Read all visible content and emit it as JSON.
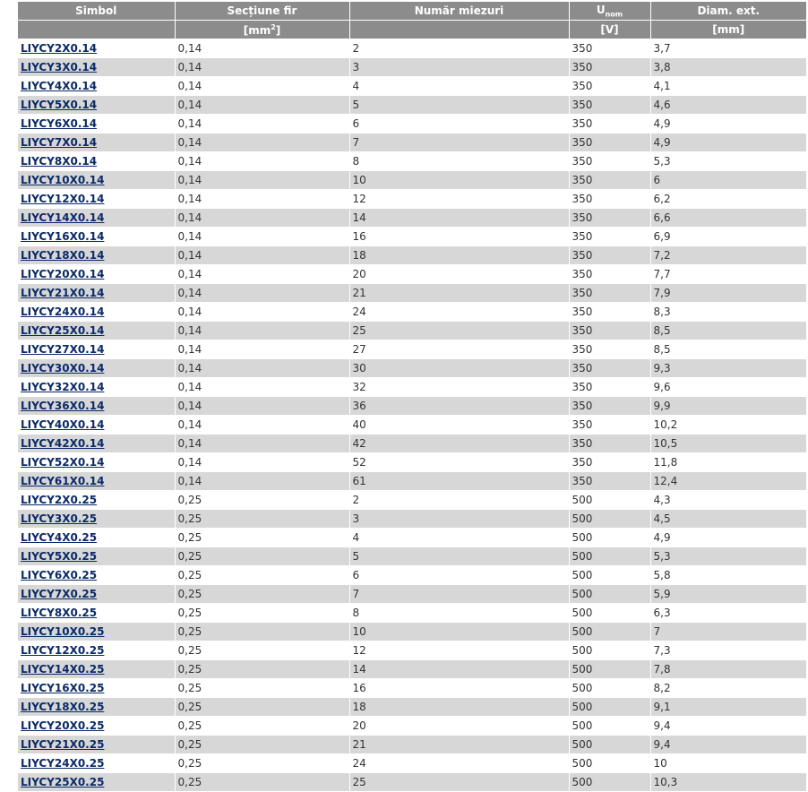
{
  "table": {
    "headers": {
      "simbol": "Simbol",
      "sectiune": "Secțiune fir",
      "numar": "Număr miezuri",
      "unom_u": "U",
      "unom_sub": "nom",
      "diam": "Diam. ext."
    },
    "units": {
      "simbol": "",
      "sectiune_pre": "[mm",
      "sectiune_sup": "2",
      "sectiune_post": "]",
      "numar": "",
      "unom": "[V]",
      "diam": "[mm]"
    },
    "rows": [
      {
        "simbol": "LIYCY2X0.14",
        "sectiune": "0,14",
        "miezuri": "2",
        "unom": "350",
        "diam": "3,7"
      },
      {
        "simbol": "LIYCY3X0.14",
        "sectiune": "0,14",
        "miezuri": "3",
        "unom": "350",
        "diam": "3,8"
      },
      {
        "simbol": "LIYCY4X0.14",
        "sectiune": "0,14",
        "miezuri": "4",
        "unom": "350",
        "diam": "4,1"
      },
      {
        "simbol": "LIYCY5X0.14",
        "sectiune": "0,14",
        "miezuri": "5",
        "unom": "350",
        "diam": "4,6"
      },
      {
        "simbol": "LIYCY6X0.14",
        "sectiune": "0,14",
        "miezuri": "6",
        "unom": "350",
        "diam": "4,9"
      },
      {
        "simbol": "LIYCY7X0.14",
        "sectiune": "0,14",
        "miezuri": "7",
        "unom": "350",
        "diam": "4,9"
      },
      {
        "simbol": "LIYCY8X0.14",
        "sectiune": "0,14",
        "miezuri": "8",
        "unom": "350",
        "diam": "5,3"
      },
      {
        "simbol": "LIYCY10X0.14",
        "sectiune": "0,14",
        "miezuri": "10",
        "unom": "350",
        "diam": "6"
      },
      {
        "simbol": "LIYCY12X0.14",
        "sectiune": "0,14",
        "miezuri": "12",
        "unom": "350",
        "diam": "6,2"
      },
      {
        "simbol": "LIYCY14X0.14",
        "sectiune": "0,14",
        "miezuri": "14",
        "unom": "350",
        "diam": "6,6"
      },
      {
        "simbol": "LIYCY16X0.14",
        "sectiune": "0,14",
        "miezuri": "16",
        "unom": "350",
        "diam": "6,9"
      },
      {
        "simbol": "LIYCY18X0.14",
        "sectiune": "0,14",
        "miezuri": "18",
        "unom": "350",
        "diam": "7,2"
      },
      {
        "simbol": "LIYCY20X0.14",
        "sectiune": "0,14",
        "miezuri": "20",
        "unom": "350",
        "diam": "7,7"
      },
      {
        "simbol": "LIYCY21X0.14",
        "sectiune": "0,14",
        "miezuri": "21",
        "unom": "350",
        "diam": "7,9"
      },
      {
        "simbol": "LIYCY24X0.14",
        "sectiune": "0,14",
        "miezuri": "24",
        "unom": "350",
        "diam": "8,3"
      },
      {
        "simbol": "LIYCY25X0.14",
        "sectiune": "0,14",
        "miezuri": "25",
        "unom": "350",
        "diam": "8,5"
      },
      {
        "simbol": "LIYCY27X0.14",
        "sectiune": "0,14",
        "miezuri": "27",
        "unom": "350",
        "diam": "8,5"
      },
      {
        "simbol": "LIYCY30X0.14",
        "sectiune": "0,14",
        "miezuri": "30",
        "unom": "350",
        "diam": "9,3"
      },
      {
        "simbol": "LIYCY32X0.14",
        "sectiune": "0,14",
        "miezuri": "32",
        "unom": "350",
        "diam": "9,6"
      },
      {
        "simbol": "LIYCY36X0.14",
        "sectiune": "0,14",
        "miezuri": "36",
        "unom": "350",
        "diam": "9,9"
      },
      {
        "simbol": "LIYCY40X0.14",
        "sectiune": "0,14",
        "miezuri": "40",
        "unom": "350",
        "diam": "10,2"
      },
      {
        "simbol": "LIYCY42X0.14",
        "sectiune": "0,14",
        "miezuri": "42",
        "unom": "350",
        "diam": "10,5"
      },
      {
        "simbol": "LIYCY52X0.14",
        "sectiune": "0,14",
        "miezuri": "52",
        "unom": "350",
        "diam": "11,8"
      },
      {
        "simbol": "LIYCY61X0.14",
        "sectiune": "0,14",
        "miezuri": "61",
        "unom": "350",
        "diam": "12,4"
      },
      {
        "simbol": "LIYCY2X0.25",
        "sectiune": "0,25",
        "miezuri": "2",
        "unom": "500",
        "diam": "4,3"
      },
      {
        "simbol": "LIYCY3X0.25",
        "sectiune": "0,25",
        "miezuri": "3",
        "unom": "500",
        "diam": "4,5"
      },
      {
        "simbol": "LIYCY4X0.25",
        "sectiune": "0,25",
        "miezuri": "4",
        "unom": "500",
        "diam": "4,9"
      },
      {
        "simbol": "LIYCY5X0.25",
        "sectiune": "0,25",
        "miezuri": "5",
        "unom": "500",
        "diam": "5,3"
      },
      {
        "simbol": "LIYCY6X0.25",
        "sectiune": "0,25",
        "miezuri": "6",
        "unom": "500",
        "diam": "5,8"
      },
      {
        "simbol": "LIYCY7X0.25",
        "sectiune": "0,25",
        "miezuri": "7",
        "unom": "500",
        "diam": "5,9"
      },
      {
        "simbol": "LIYCY8X0.25",
        "sectiune": "0,25",
        "miezuri": "8",
        "unom": "500",
        "diam": "6,3"
      },
      {
        "simbol": "LIYCY10X0.25",
        "sectiune": "0,25",
        "miezuri": "10",
        "unom": "500",
        "diam": "7"
      },
      {
        "simbol": "LIYCY12X0.25",
        "sectiune": "0,25",
        "miezuri": "12",
        "unom": "500",
        "diam": "7,3"
      },
      {
        "simbol": "LIYCY14X0.25",
        "sectiune": "0,25",
        "miezuri": "14",
        "unom": "500",
        "diam": "7,8"
      },
      {
        "simbol": "LIYCY16X0.25",
        "sectiune": "0,25",
        "miezuri": "16",
        "unom": "500",
        "diam": "8,2"
      },
      {
        "simbol": "LIYCY18X0.25",
        "sectiune": "0,25",
        "miezuri": "18",
        "unom": "500",
        "diam": "9,1"
      },
      {
        "simbol": "LIYCY20X0.25",
        "sectiune": "0,25",
        "miezuri": "20",
        "unom": "500",
        "diam": "9,4"
      },
      {
        "simbol": "LIYCY21X0.25",
        "sectiune": "0,25",
        "miezuri": "21",
        "unom": "500",
        "diam": "9,4"
      },
      {
        "simbol": "LIYCY24X0.25",
        "sectiune": "0,25",
        "miezuri": "24",
        "unom": "500",
        "diam": "10"
      },
      {
        "simbol": "LIYCY25X0.25",
        "sectiune": "0,25",
        "miezuri": "25",
        "unom": "500",
        "diam": "10,3"
      }
    ]
  },
  "colors": {
    "header_bg": "#8c8c8c",
    "row_alt_bg": "#d7d7d7",
    "link": "#0b2a66"
  }
}
